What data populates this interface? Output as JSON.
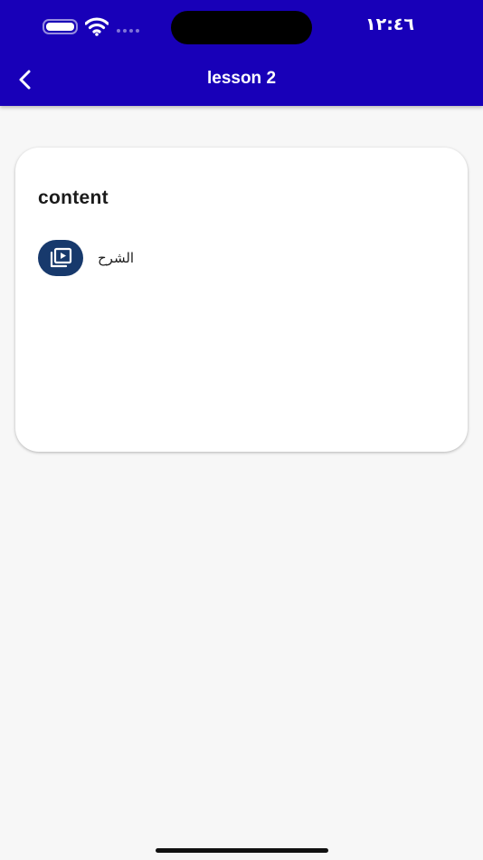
{
  "status_bar": {
    "time": "١٢:٤٦"
  },
  "nav": {
    "title": "lesson 2",
    "back_icon": "chevron-left-icon"
  },
  "content_card": {
    "title": "content",
    "items": [
      {
        "label": "الشرح",
        "icon": "video-library-icon"
      }
    ]
  },
  "colors": {
    "app_bar": "#1800b8",
    "item_icon_bg": "#17396c",
    "background": "#f7f7f7"
  }
}
